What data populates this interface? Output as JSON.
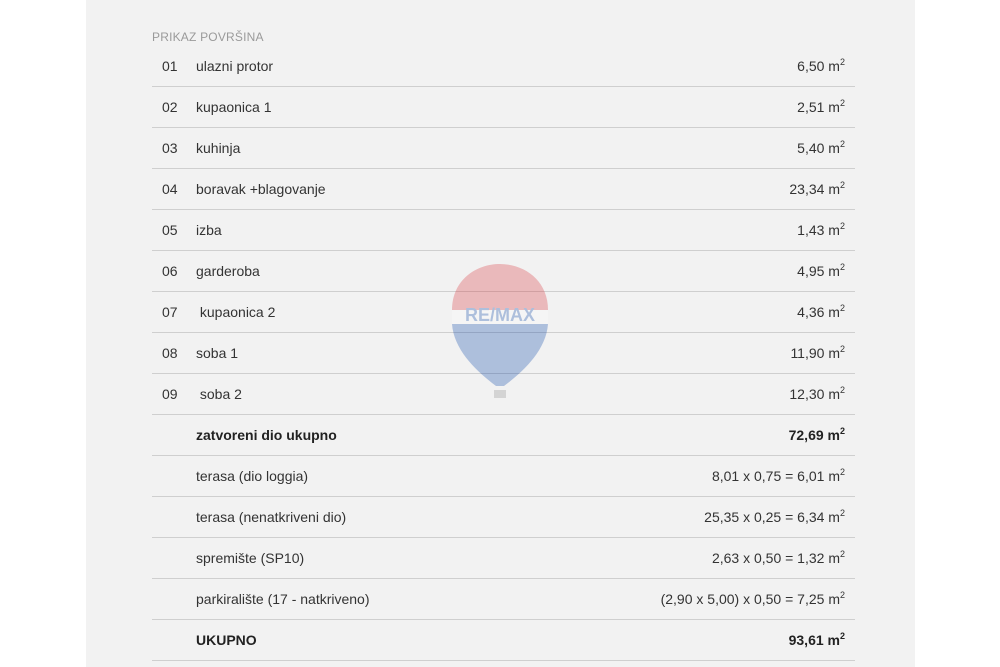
{
  "section_title": "PRIKAZ POVRŠINA",
  "watermark_text": "RE/MAX",
  "colors": {
    "panel_background": "#f2f2f2",
    "divider": "#cfcfcf",
    "text": "#333333",
    "title": "#9a9a9a",
    "watermark_red": "#d7282f",
    "watermark_blue": "#003da5"
  },
  "rows": [
    {
      "num": "01",
      "label": "ulazni protor",
      "value": "6,50 m",
      "sup": "2"
    },
    {
      "num": "02",
      "label": "kupaonica 1",
      "value": "2,51 m",
      "sup": "2"
    },
    {
      "num": "03",
      "label": "kuhinja",
      "value": "5,40 m",
      "sup": "2"
    },
    {
      "num": "04",
      "label": "boravak +blagovanje",
      "value": "23,34 m",
      "sup": "2"
    },
    {
      "num": "05",
      "label": "izba",
      "value": "1,43 m",
      "sup": "2"
    },
    {
      "num": "06",
      "label": "garderoba",
      "value": "4,95 m",
      "sup": "2"
    },
    {
      "num": "07",
      "label": " kupaonica 2",
      "value": "4,36 m",
      "sup": "2"
    },
    {
      "num": "08",
      "label": "soba 1",
      "value": "11,90 m",
      "sup": "2"
    },
    {
      "num": "09",
      "label": " soba 2",
      "value": "12,30 m",
      "sup": "2"
    },
    {
      "num": "",
      "label": "zatvoreni dio ukupno",
      "value": "72,69 m",
      "sup": "2",
      "bold": true
    },
    {
      "num": "",
      "label": "terasa (dio loggia)",
      "value": "8,01 x 0,75 = 6,01 m",
      "sup": "2"
    },
    {
      "num": "",
      "label": "terasa (nenatkriveni dio)",
      "value": "25,35 x 0,25 = 6,34 m",
      "sup": "2"
    },
    {
      "num": "",
      "label": "spremište (SP10)",
      "value": "2,63 x 0,50 = 1,32 m",
      "sup": "2"
    },
    {
      "num": "",
      "label": "parkiralište (17 - natkriveno)",
      "value": "(2,90 x 5,00) x 0,50 = 7,25 m",
      "sup": "2"
    },
    {
      "num": "",
      "label": "UKUPNO",
      "value": "93,61 m",
      "sup": "2",
      "bold": true
    }
  ]
}
